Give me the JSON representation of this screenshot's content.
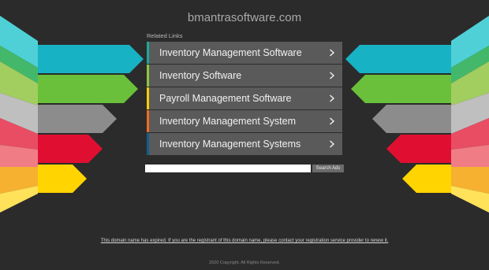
{
  "site": {
    "domain": "bmantrasoftware.com"
  },
  "related": {
    "heading": "Related Links",
    "links": [
      {
        "label": "Inventory Management Software",
        "accent": "#1aa79e",
        "icon": "chevron-right-icon"
      },
      {
        "label": "Inventory Software",
        "accent": "#8cc63e",
        "icon": "chevron-right-icon"
      },
      {
        "label": "Payroll Management Software",
        "accent": "#f2d000",
        "icon": "chevron-right-icon"
      },
      {
        "label": "Inventory Management System",
        "accent": "#f06a22",
        "icon": "chevron-right-icon"
      },
      {
        "label": "Inventory Management Systems",
        "accent": "#0f5f8e",
        "icon": "chevron-right-icon"
      }
    ]
  },
  "search": {
    "placeholder": "",
    "button_label": "Search Ads"
  },
  "footer": {
    "notice": "This domain name has expired. If you are the registrant of this domain name, please contact your registration service provider to renew it.",
    "copyright": "2020 Copyright. All Rights Reserved."
  },
  "decoration": {
    "band_colors": [
      "#17b2c4",
      "#6ac03a",
      "#8c8c8c",
      "#e00f31",
      "#ffd400"
    ],
    "outer_colors": [
      "#4fd0d6",
      "#43b86a",
      "#a2cd5f",
      "#bfbfbf",
      "#e84d64",
      "#f07c86",
      "#f6b130",
      "#ffe25a"
    ]
  }
}
